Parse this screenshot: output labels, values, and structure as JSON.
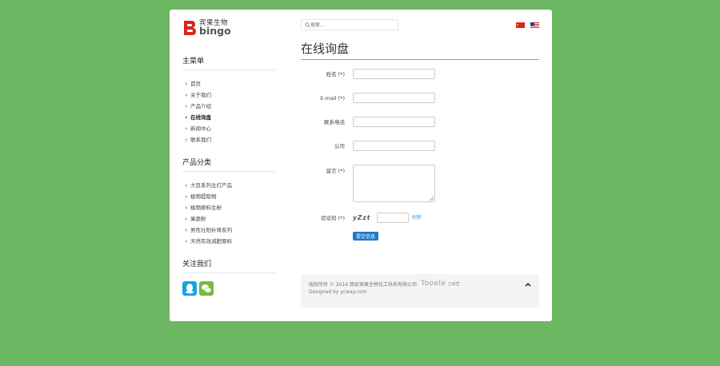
{
  "brand": {
    "cn": "宾果生物",
    "en": "bingo"
  },
  "search": {
    "placeholder": "搜索..."
  },
  "sidebar": {
    "main_menu_title": "主菜单",
    "main_menu": [
      "首页",
      "关于我们",
      "产品介绍",
      "在线询盘",
      "新闻中心",
      "联系我们"
    ],
    "active_index": 3,
    "category_title": "产品分类",
    "categories": [
      "大豆系列主打产品",
      "植物提取物",
      "植物原料生粉",
      "果蔬粉",
      "男性壮阳补肾系列",
      "天然有效减肥原料"
    ],
    "follow_title": "关注我们"
  },
  "main": {
    "title": "在线询盘",
    "form": {
      "name_label": "姓名 (*)",
      "email_label": "E-mail (*)",
      "phone_label": "联系电话",
      "company_label": "公司",
      "message_label": "留言 (*)",
      "captcha_label": "验证码 (*)",
      "captcha_text": "yZzt",
      "refresh_label": "刷新",
      "submit_label": "提交信息"
    }
  },
  "footer": {
    "copyright": "版权所有 © 2014 西安宾果生物化工科技有限公司",
    "tooele": "Tooele",
    "tooele_sub": "王朝营",
    "designed": "Designed by ycway.com"
  },
  "colors": {
    "page_bg": "#6cb862",
    "accent": "#6cb862",
    "submit": "#1e7ac8",
    "logo_red": "#d8261f"
  }
}
